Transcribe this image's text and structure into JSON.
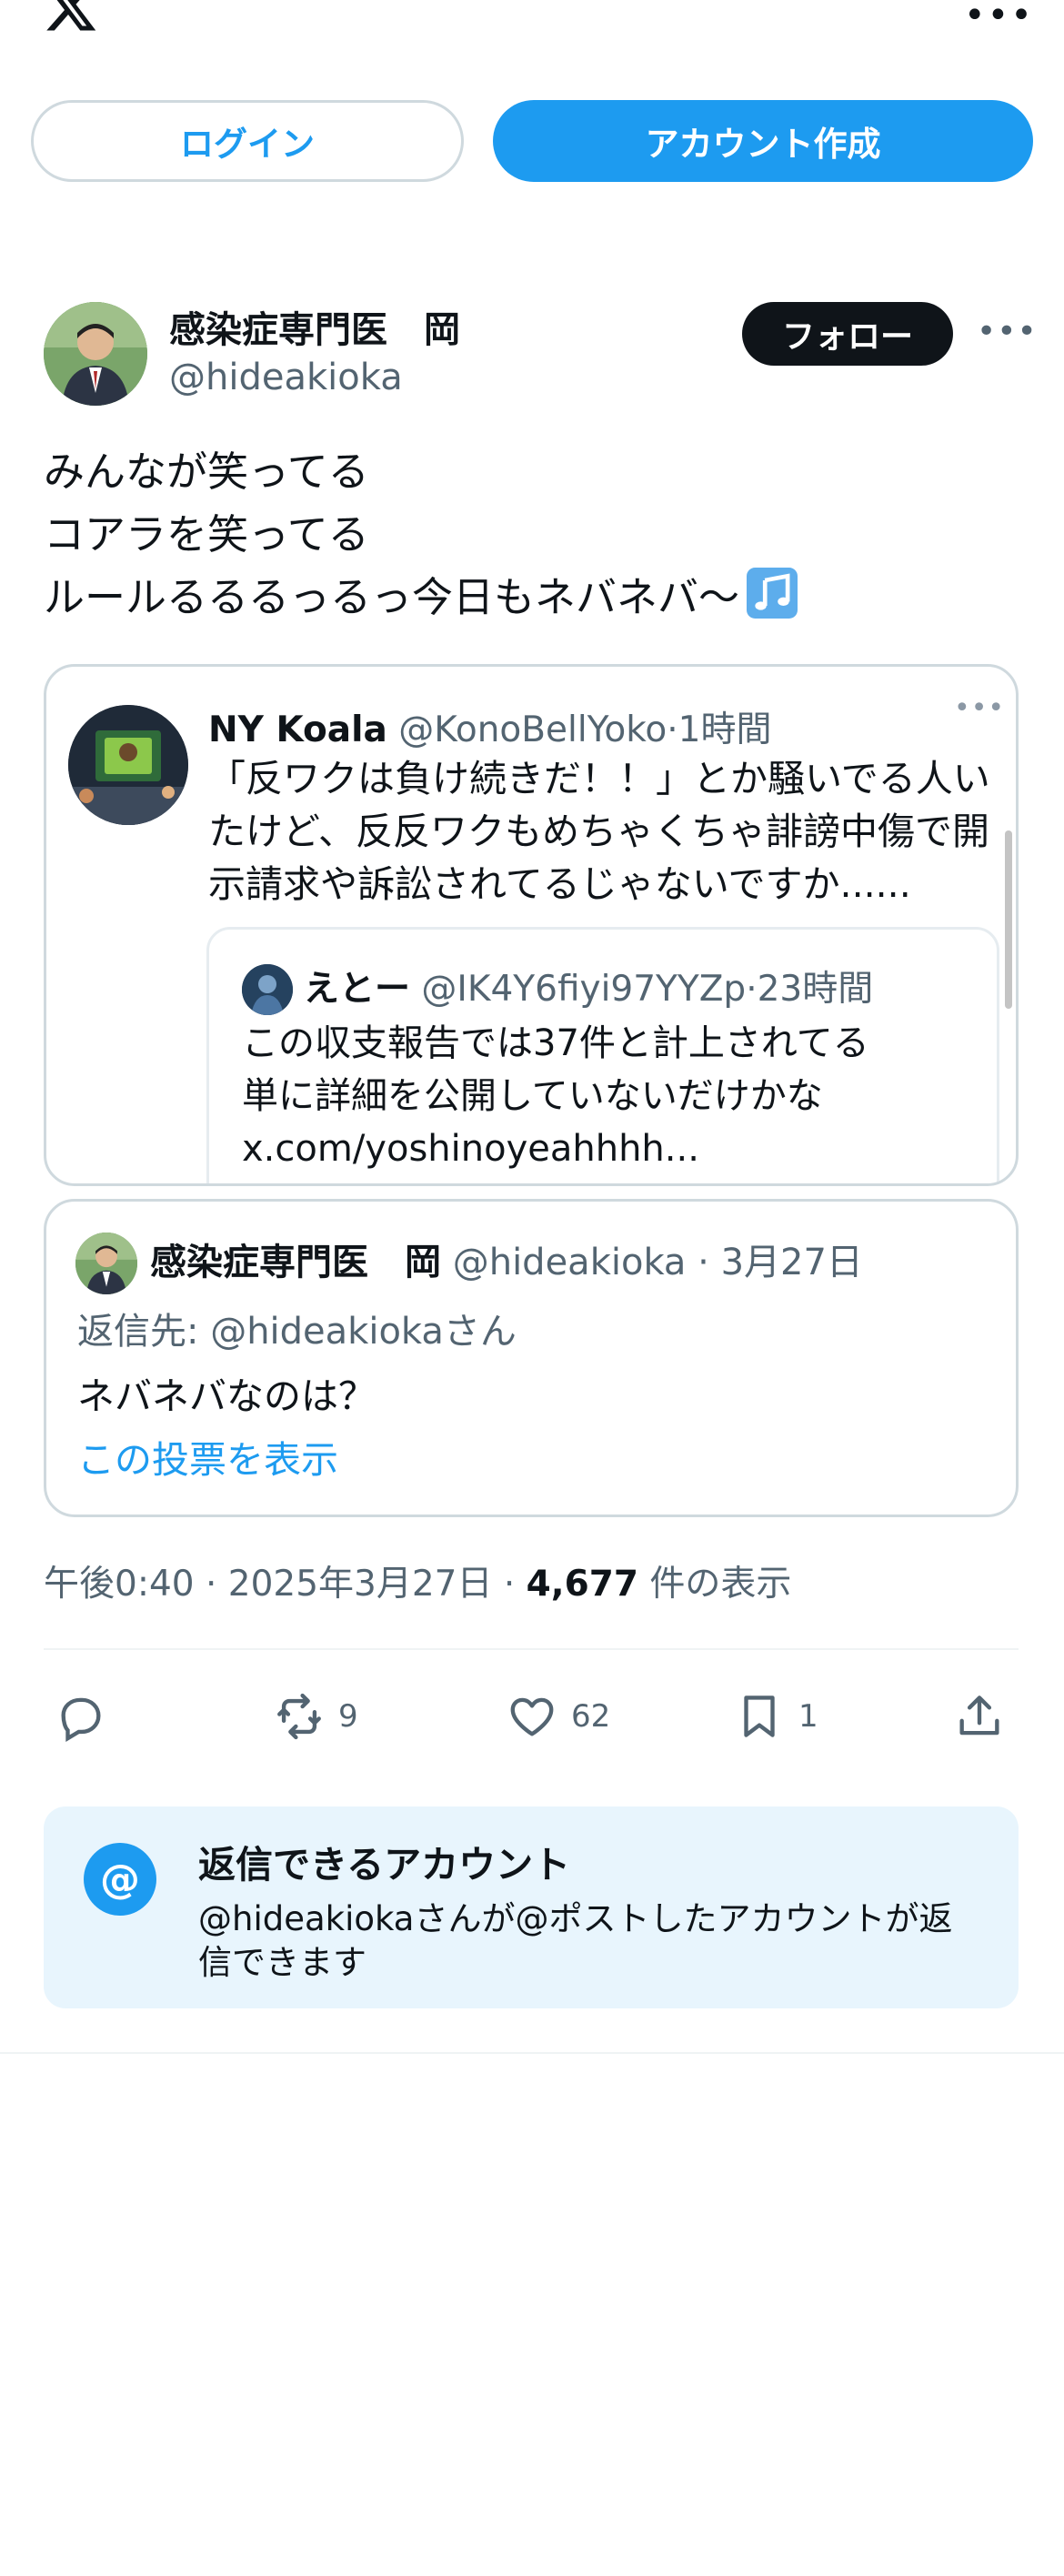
{
  "header": {
    "login_label": "ログイン",
    "signup_label": "アカウント作成",
    "more_icon": "ellipsis-icon"
  },
  "post": {
    "author_name": "感染症専門医　岡",
    "author_handle": "@hideakioka",
    "follow_label": "フォロー",
    "text_lines": [
      "みんなが笑ってる",
      "コアラを笑ってる",
      "ルールるるるっるっ今日もネバネバ〜"
    ],
    "emoji_icon": "musical-notes-icon",
    "timestamp": "午後0:40 · 2025年3月27日 · ",
    "views_count": "4,677",
    "views_label": " 件の表示"
  },
  "quote": {
    "name": "NY Koala",
    "handle": "@KonoBellYoko",
    "time": "1時間",
    "lines": [
      "「反ワクは負け続きだ！！」とか騒いでる人い",
      "たけど、反反ワクもめちゃくちゃ誹謗中傷で開",
      "示請求や訴訟されてるじゃないですか......"
    ],
    "nested": {
      "name": "えとー",
      "handle": "@IK4Y6fiyi97YYZp",
      "time": "23時間",
      "lines": [
        "この収支報告では37件と計上されてる",
        "単に詳細を公開していないだけかな",
        "x.com/yoshinoyeahhhh..."
      ]
    }
  },
  "reply_card": {
    "name": "感染症専門医　岡",
    "handle": "@hideakioka",
    "date": "3月27日",
    "reply_to": "返信先: @hideakiokaさん",
    "text": "ネバネバなのは？",
    "link": "この投票を表示"
  },
  "actions": {
    "reply_icon": "comment-icon",
    "retweet_icon": "retweet-icon",
    "retweet_count": "9",
    "like_icon": "heart-icon",
    "like_count": "62",
    "bookmark_icon": "bookmark-icon",
    "bookmark_count": "1",
    "share_icon": "share-icon"
  },
  "reply_info": {
    "title": "返信できるアカウント",
    "description": "@hideakiokaさんが@ポストしたアカウントが返信できます"
  },
  "colors": {
    "accent": "#1d9bf0",
    "text": "#0f1419",
    "secondary": "#536471",
    "info_bg": "#e8f5fd"
  }
}
